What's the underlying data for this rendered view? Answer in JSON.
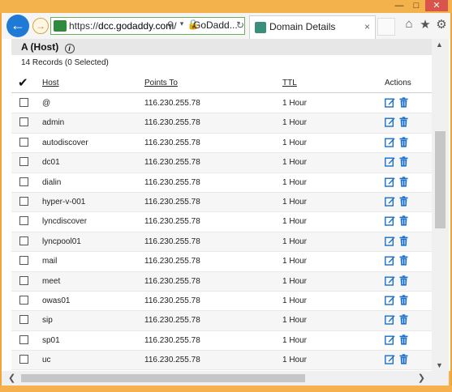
{
  "browser": {
    "url_scheme": "https://",
    "url_host": "dcc.godaddy.com",
    "url_rest": "/",
    "site_badge": "GoDadd...",
    "tab_title": "Domain Details",
    "tab_close": "×",
    "accent": "#1e7ad6",
    "frame_color": "#f6b14e"
  },
  "section": {
    "title": "A (Host)",
    "records_summary": "14 Records (0 Selected)"
  },
  "columns": {
    "host": "Host",
    "points_to": "Points To",
    "ttl": "TTL",
    "actions": "Actions"
  },
  "records": [
    {
      "host": "@",
      "points_to": "116.230.255.78",
      "ttl": "1 Hour"
    },
    {
      "host": "admin",
      "points_to": "116.230.255.78",
      "ttl": "1 Hour"
    },
    {
      "host": "autodiscover",
      "points_to": "116.230.255.78",
      "ttl": "1 Hour"
    },
    {
      "host": "dc01",
      "points_to": "116.230.255.78",
      "ttl": "1 Hour"
    },
    {
      "host": "dialin",
      "points_to": "116.230.255.78",
      "ttl": "1 Hour"
    },
    {
      "host": "hyper-v-001",
      "points_to": "116.230.255.78",
      "ttl": "1 Hour"
    },
    {
      "host": "lyncdiscover",
      "points_to": "116.230.255.78",
      "ttl": "1 Hour"
    },
    {
      "host": "lyncpool01",
      "points_to": "116.230.255.78",
      "ttl": "1 Hour"
    },
    {
      "host": "mail",
      "points_to": "116.230.255.78",
      "ttl": "1 Hour"
    },
    {
      "host": "meet",
      "points_to": "116.230.255.78",
      "ttl": "1 Hour"
    },
    {
      "host": "owas01",
      "points_to": "116.230.255.78",
      "ttl": "1 Hour"
    },
    {
      "host": "sip",
      "points_to": "116.230.255.78",
      "ttl": "1 Hour"
    },
    {
      "host": "sp01",
      "points_to": "116.230.255.78",
      "ttl": "1 Hour"
    },
    {
      "host": "uc",
      "points_to": "116.230.255.78",
      "ttl": "1 Hour"
    }
  ],
  "icons": {
    "edit": "edit-icon",
    "delete": "trash-icon",
    "action_color": "#1a6fc9"
  }
}
